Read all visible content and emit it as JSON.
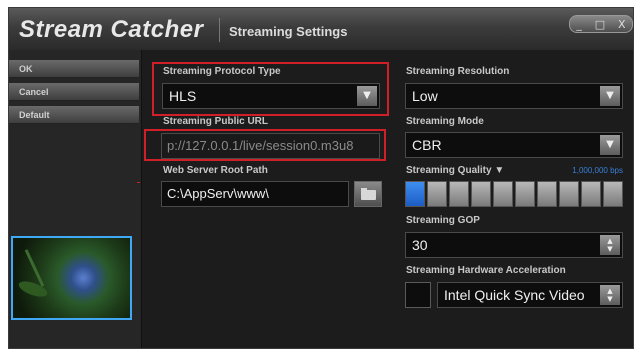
{
  "window": {
    "app_title": "Stream Catcher",
    "section_title": "Streaming Settings",
    "controls_label": "_ □ X"
  },
  "sidebar": {
    "buttons": [
      {
        "label": "OK"
      },
      {
        "label": "Cancel"
      },
      {
        "label": "Default"
      }
    ]
  },
  "left_panel": {
    "protocol_label": "Streaming Protocol Type",
    "protocol_value": "HLS",
    "public_url_label": "Streaming Public URL",
    "public_url_value": "p://127.0.0.1/live/session0.m3u8",
    "root_path_label": "Web Server Root Path",
    "root_path_value": "C:\\AppServ\\www\\"
  },
  "right_panel": {
    "resolution_label": "Streaming Resolution",
    "resolution_value": "Low",
    "mode_label": "Streaming Mode",
    "mode_value": "CBR",
    "quality_label": "Streaming Quality ▼",
    "quality_value": "1,000,000 bps",
    "quality_level": 0.1,
    "quality_segments_total": 10,
    "quality_segments_on": 1,
    "gop_label": "Streaming GOP",
    "gop_value": "30",
    "hw_accel_label": "Streaming Hardware Acceleration",
    "hw_accel_value": "Intel Quick Sync Video",
    "hw_accel_checked": false
  },
  "icons": {
    "dropdown": "triangle-down-icon",
    "folder": "folder-icon",
    "spinner": "up-down-arrows-icon"
  },
  "colors": {
    "highlight_border": "#d11f2a",
    "preview_border": "#3fa9f5",
    "quality_accent": "#2f78e0",
    "quality_value_text": "#3a7fd8"
  }
}
